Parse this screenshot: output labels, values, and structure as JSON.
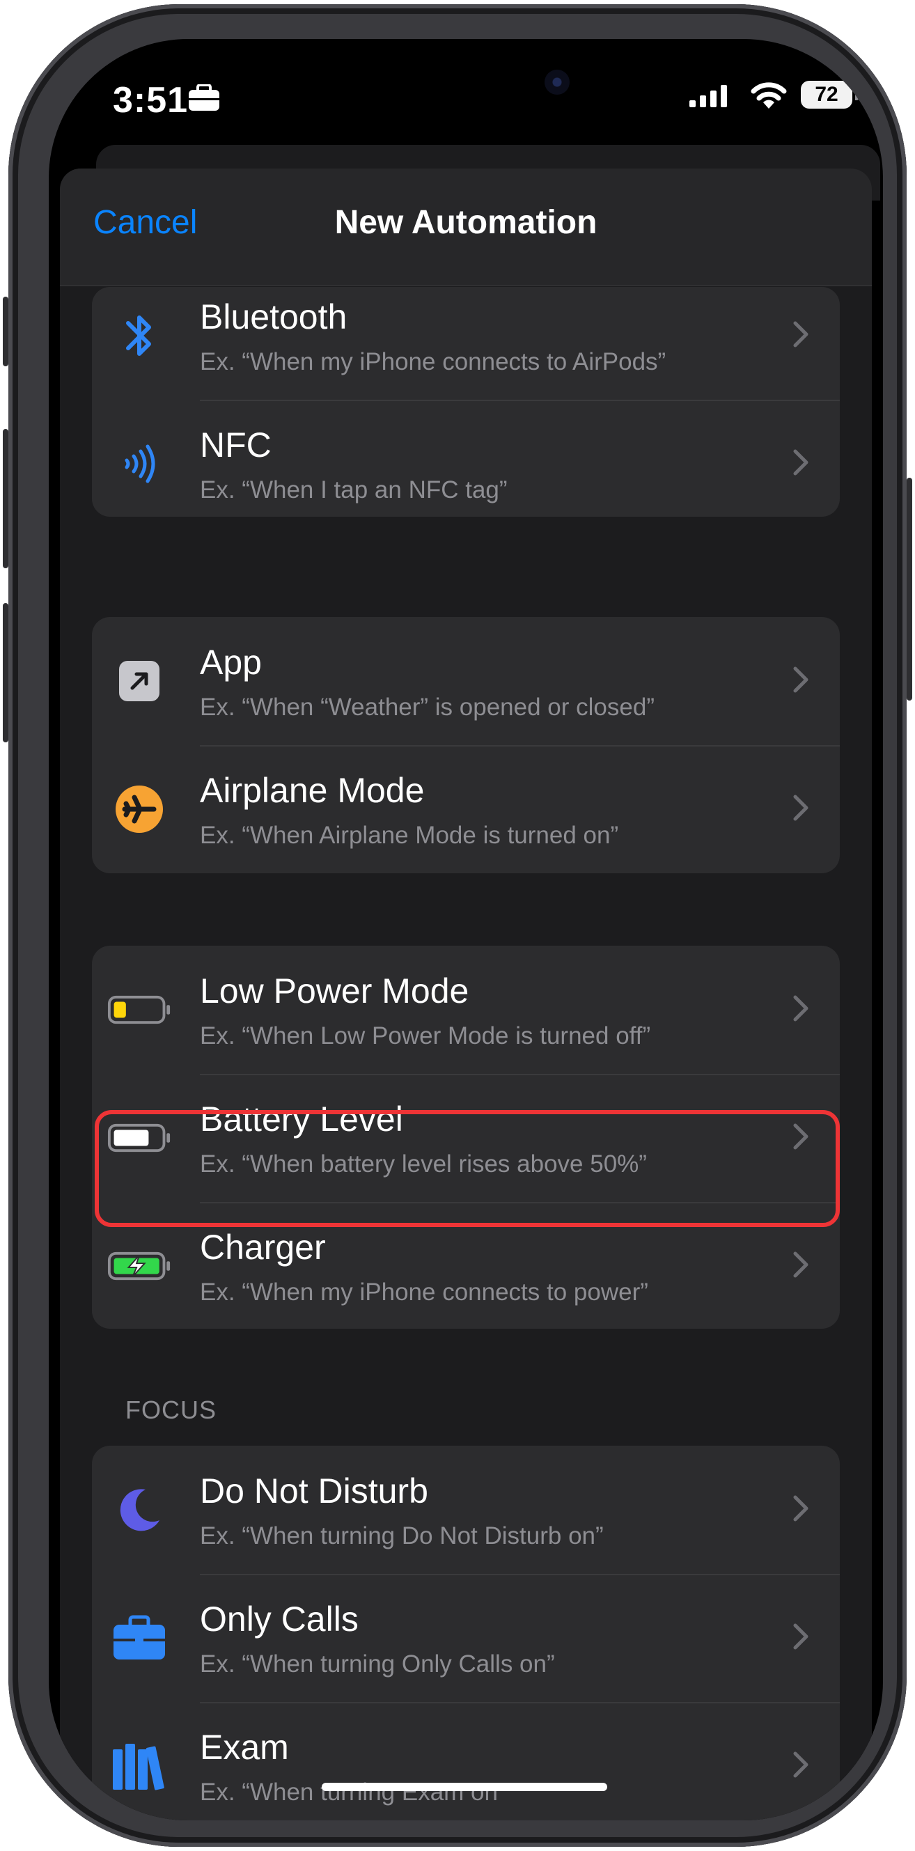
{
  "status": {
    "time": "3:51",
    "battery_percent": "72"
  },
  "nav": {
    "cancel_label": "Cancel",
    "title": "New Automation"
  },
  "groups": {
    "connectivity": [
      {
        "title": "Bluetooth",
        "subtitle": "Ex. “When my iPhone connects to AirPods”",
        "icon": "bluetooth-icon"
      },
      {
        "title": "NFC",
        "subtitle": "Ex. “When I tap an NFC tag”",
        "icon": "nfc-icon"
      }
    ],
    "apps": [
      {
        "title": "App",
        "subtitle": "Ex. “When “Weather” is opened or closed”",
        "icon": "app-icon"
      },
      {
        "title": "Airplane Mode",
        "subtitle": "Ex. “When Airplane Mode is turned on”",
        "icon": "airplane-icon"
      }
    ],
    "power": [
      {
        "title": "Low Power Mode",
        "subtitle": "Ex. “When Low Power Mode is turned off”",
        "icon": "low-battery-icon"
      },
      {
        "title": "Battery Level",
        "subtitle": "Ex. “When battery level rises above 50%”",
        "icon": "battery-icon"
      },
      {
        "title": "Charger",
        "subtitle": "Ex. “When my iPhone connects to power”",
        "icon": "charging-battery-icon"
      }
    ],
    "focus_label": "FOCUS",
    "focus": [
      {
        "title": "Do Not Disturb",
        "subtitle": "Ex. “When turning Do Not Disturb on”",
        "icon": "moon-icon"
      },
      {
        "title": "Only Calls",
        "subtitle": "Ex. “When turning Only Calls on”",
        "icon": "briefcase-icon"
      },
      {
        "title": "Exam",
        "subtitle": "Ex. “When turning Exam on”",
        "icon": "books-icon"
      }
    ]
  },
  "colors": {
    "accent": "#0a84ff",
    "highlight": "#ee3436",
    "airplane": "#f7a333",
    "low_power": "#ffd60a",
    "charging": "#32d74b",
    "moon": "#5e5ce6"
  }
}
